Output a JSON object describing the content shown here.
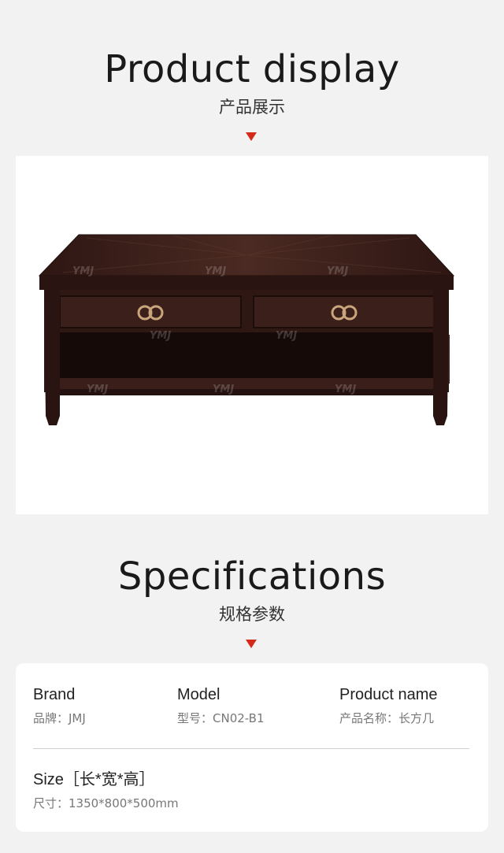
{
  "display": {
    "title": "Product display",
    "subtitle": "产品展示"
  },
  "product": {
    "image": "dark walnut rectangular coffee table with two drawers and lower shelf",
    "watermark": "YMJ"
  },
  "specs": {
    "title": "Specifications",
    "subtitle": "规格参数",
    "brand_label": "Brand",
    "brand_value": "品牌：JMJ",
    "model_label": "Model",
    "model_value": "型号：CN02-B1",
    "name_label": "Product name",
    "name_value": "产品名称：长方几",
    "size_label": "Size［长*宽*高］",
    "size_value": "尺寸：1350*800*500mm"
  },
  "colors": {
    "accent": "#d42a1c",
    "background": "#f2f2f2",
    "wood": "#3b1f1a"
  },
  "icons": [
    "down-arrow-icon",
    "down-arrow-icon"
  ]
}
